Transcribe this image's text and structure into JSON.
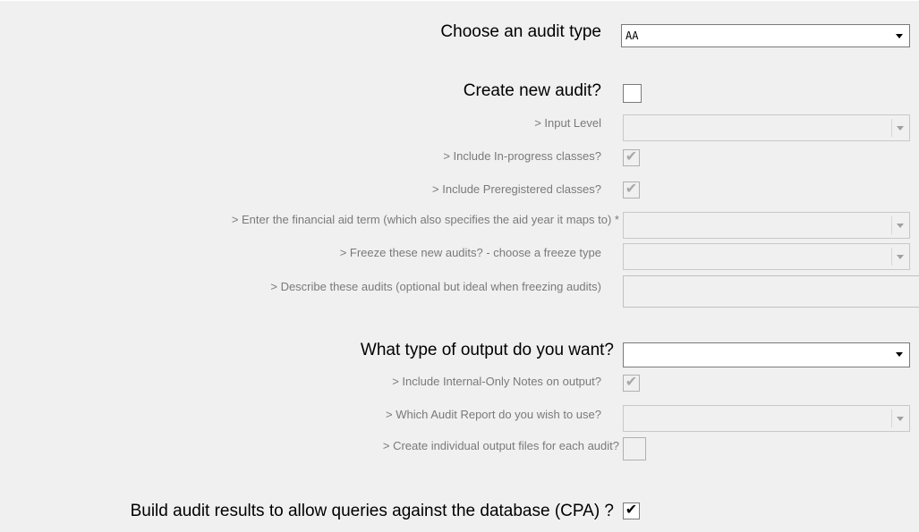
{
  "audit_type": {
    "label": "Choose an audit type",
    "value": "AA"
  },
  "create_new": {
    "label": "Create new audit?",
    "checked": false
  },
  "input_level": {
    "label": "> Input Level",
    "value": ""
  },
  "inprogress": {
    "label": "> Include In-progress classes?",
    "checked": true
  },
  "preregistered": {
    "label": "> Include Preregistered classes?",
    "checked": true
  },
  "aid_term": {
    "label": "> Enter the financial aid term (which also specifies the aid year it maps to) *",
    "value": ""
  },
  "freeze": {
    "label": "> Freeze these new audits? - choose a freeze type",
    "value": ""
  },
  "describe": {
    "label": "> Describe these audits (optional but ideal when freezing audits)",
    "value": ""
  },
  "output_type": {
    "label": "What type of output do you want?",
    "value": ""
  },
  "internal_notes": {
    "label": "> Include Internal-Only Notes on output?",
    "checked": true
  },
  "audit_report": {
    "label": "> Which Audit Report do you wish to use?",
    "value": ""
  },
  "individual_files": {
    "label": "> Create individual output files for each audit?",
    "checked": false
  },
  "cpa": {
    "label": "Build audit results to allow queries against the database (CPA) ?",
    "checked": true
  },
  "check_glyph": "✔"
}
